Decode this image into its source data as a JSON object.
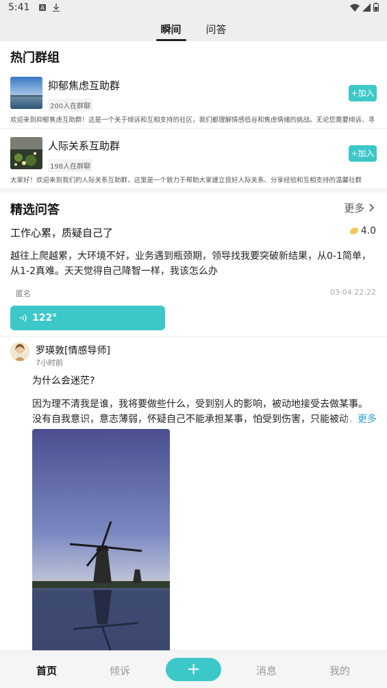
{
  "status_bar": {
    "time": "5:41"
  },
  "top_tabs": [
    {
      "label": "瞬间",
      "active": true
    },
    {
      "label": "问答",
      "active": false
    }
  ],
  "hot_groups": {
    "title": "热门群组",
    "items": [
      {
        "name": "抑郁焦虑互助群",
        "count": "200人在群聊",
        "join": "+加入",
        "desc": "欢迎来到抑郁焦虑互助群！这是一个关于倾诉和互相支持的社区，我们都理解情感低谷和焦虑情绪的挑战。无论您需要倾诉、寻"
      },
      {
        "name": "人际关系互助群",
        "count": "198人在群聊",
        "join": "+加入",
        "desc": "大家好！欢迎来到我们的人际关系互助群，这里是一个致力于帮助大家建立良好人际关系、分享经验和互相支持的温馨社群"
      }
    ]
  },
  "featured_qa": {
    "title": "精选问答",
    "more": "更多",
    "question": {
      "title": "工作心累，质疑自己了",
      "reward": "4.0",
      "body": "越往上爬越累，大环境不好，业务遇到瓶颈期，领导找我要突破新结果，从0-1简单，从1-2真难。天天觉得自己降智一样，我该怎么办",
      "author": "匿名",
      "time": "03-04 22:22",
      "voice": "122°"
    },
    "answer": {
      "name": "罗瑛敦[情感导师]",
      "time": "7小时前",
      "question": "为什么会迷茫?",
      "body": "因为理不清我是谁，我将要做些什么，受到别人的影响，被动地接受去做某事。没有自我意识，意志薄弱，怀疑自己不能承担某事，怕受到伤害，只能被动，躲避，回避",
      "more": "更多"
    }
  },
  "bottom_nav": [
    {
      "label": "首页",
      "active": true
    },
    {
      "label": "倾诉",
      "active": false
    },
    {
      "label": "+",
      "active": false
    },
    {
      "label": "消息",
      "active": false
    },
    {
      "label": "我的",
      "active": false
    }
  ],
  "colors": {
    "accent": "#3cc8c8",
    "link": "#2e9fd8"
  }
}
